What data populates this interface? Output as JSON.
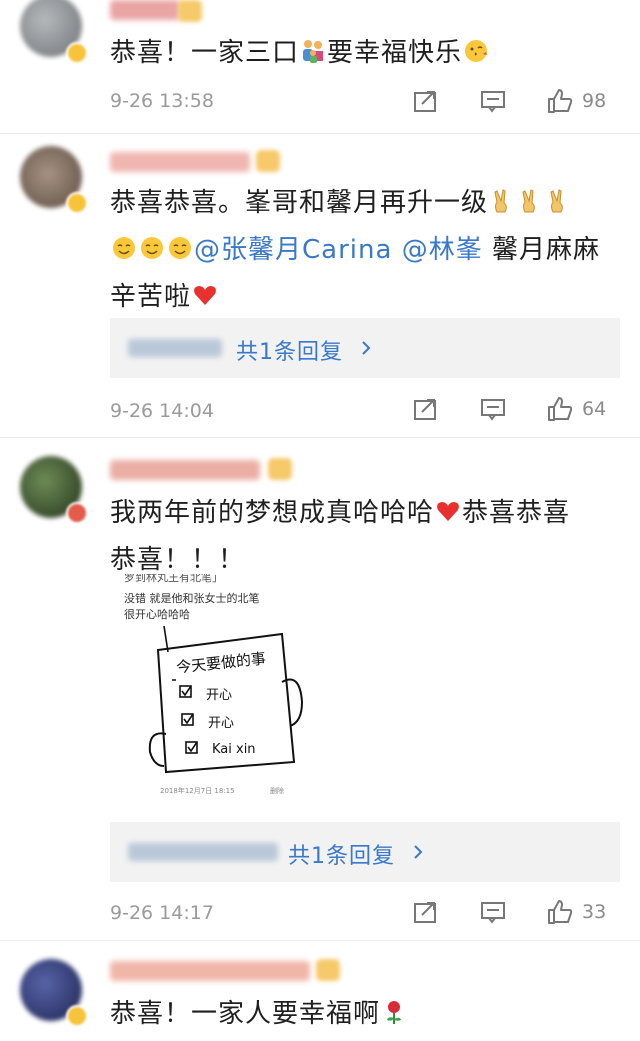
{
  "comments": [
    {
      "text_parts": [
        "恭喜！一家三口",
        "要幸福快乐"
      ],
      "time": "9-26 13:58",
      "likes": "98",
      "avatar_color": "#8a8d90"
    },
    {
      "text_line1": "恭喜恭喜。峯哥和馨月再升一级",
      "mention1": "@张馨月Carina",
      "mention2": "@林峯",
      "text_line2_tail": " 馨月麻麻",
      "text_line3": "辛苦啦",
      "reply_prefix": "··· ocky",
      "reply_label": "共1条回复",
      "time": "9-26 14:04",
      "likes": "64",
      "avatar_color": "#7a6a5c"
    },
    {
      "text_line1": "我两年前的梦想成真哈哈哈",
      "text_line1_tail": "恭喜恭喜",
      "text_line2": "恭喜！！！",
      "image": {
        "top_cut": "罗到林丸王有北笔」",
        "caption1": "没错 就是他和张女士的北笔",
        "caption2": "很开心哈哈哈",
        "sign_title": "今天要做的事",
        "items": [
          "开心",
          "开心",
          "Kai xin"
        ],
        "footer_date": "2018年12月7日 18:15",
        "footer_delete": "删除"
      },
      "reply_label": "共1条回复",
      "time": "9-26 14:17",
      "likes": "33",
      "avatar_color": "#3d5a32"
    },
    {
      "text": "恭喜！一家人要幸福啊",
      "avatar_color": "#2d3a7a"
    }
  ],
  "icons": {
    "share": "share-icon",
    "comment": "comment-icon",
    "like": "thumb-up-icon"
  }
}
